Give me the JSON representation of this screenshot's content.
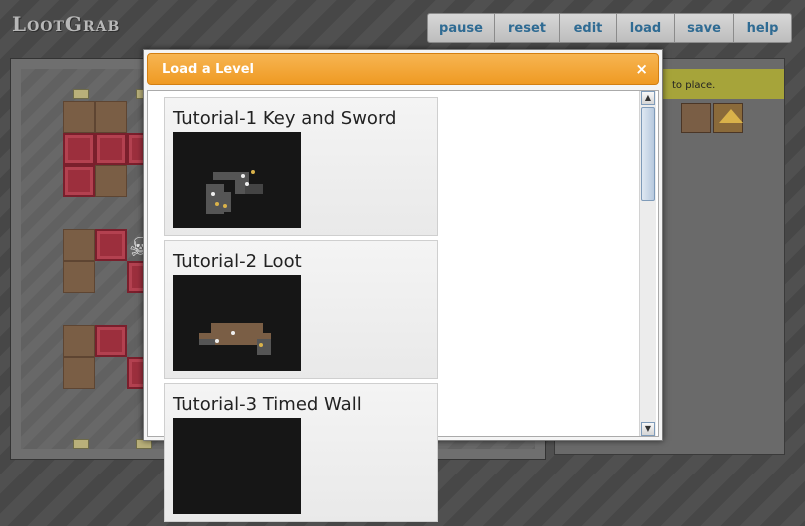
{
  "app": {
    "logo": "LootGrab"
  },
  "toolbar": {
    "buttons": [
      "pause",
      "reset",
      "edit",
      "load",
      "save",
      "help"
    ]
  },
  "palette": {
    "hint": "to place."
  },
  "dialog": {
    "title": "Load a Level",
    "close_icon": "close-icon",
    "levels": [
      {
        "name": "Tutorial-1 Key and Sword"
      },
      {
        "name": "Tutorial-2 Loot"
      },
      {
        "name": "Tutorial-3 Timed Wall"
      }
    ]
  },
  "colors": {
    "accent_orange": "#f2a33a",
    "button_text": "#2f6b93",
    "brick": "#9c2f3d"
  }
}
